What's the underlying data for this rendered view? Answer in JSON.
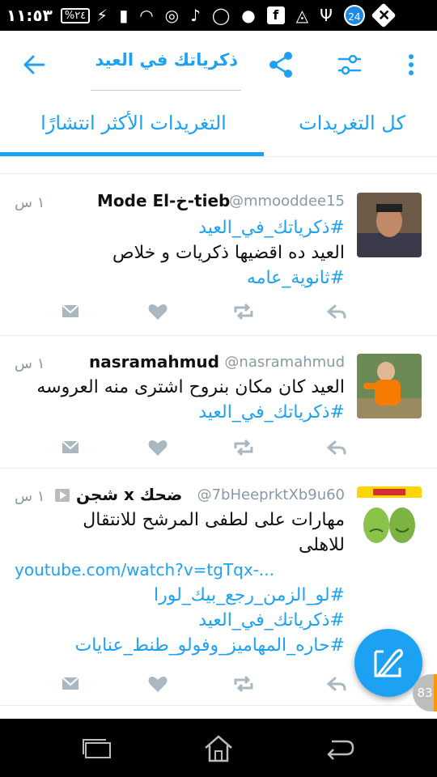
{
  "status_bar": {
    "time": "١١:٥٣",
    "battery": "%٢٤",
    "notif_badge": "24"
  },
  "toolbar": {
    "search_query": "ذكرياتك في العيد"
  },
  "tabs": [
    {
      "label": "التغريدات الأكثر انتشارًا"
    },
    {
      "label": "كل التغريدات"
    }
  ],
  "tweets": [
    {
      "name": "Mode El-خ-tieb",
      "handle": "@mmooddee15",
      "time": "١ س",
      "lines": [
        {
          "text": "#ذكرياتك_في_العيد",
          "type": "tag"
        },
        {
          "text": "العيد ده اقضيها ذكريات و خلاص",
          "type": "text"
        },
        {
          "text": "#ثانوية_عامه",
          "type": "tag"
        }
      ]
    },
    {
      "name": "nasramahmud",
      "handle": "@nasramahmud",
      "time": "١ س",
      "lines": [
        {
          "text": "العيد كان مكان بنروح اشترى منه العروسه",
          "type": "text"
        },
        {
          "text": "#ذكرياتك_في_العيد",
          "type": "tag"
        }
      ]
    },
    {
      "name": "شجن x ضحك",
      "handle": "@7bHeeprktXb9u60",
      "time": "١ س",
      "lines": [
        {
          "text": "مهارات على لطفى المرشح للانتقال",
          "type": "text"
        },
        {
          "text": "للاهلى",
          "type": "text"
        },
        {
          "text": "youtube.com/watch?v=tgTqx-...",
          "type": "link"
        },
        {
          "text": "#لو_الزمن_رجع_بيك_لورا",
          "type": "tag"
        },
        {
          "text": "#ذكرياتك_في_العيد",
          "type": "tag"
        },
        {
          "text": "#حاره_المهاميز_وفولو_طنط_عنايات",
          "type": "tag"
        }
      ]
    }
  ],
  "counter_badge": "83",
  "colors": {
    "accent": "#1da1f2",
    "icon_gray": "#aab8c2"
  }
}
